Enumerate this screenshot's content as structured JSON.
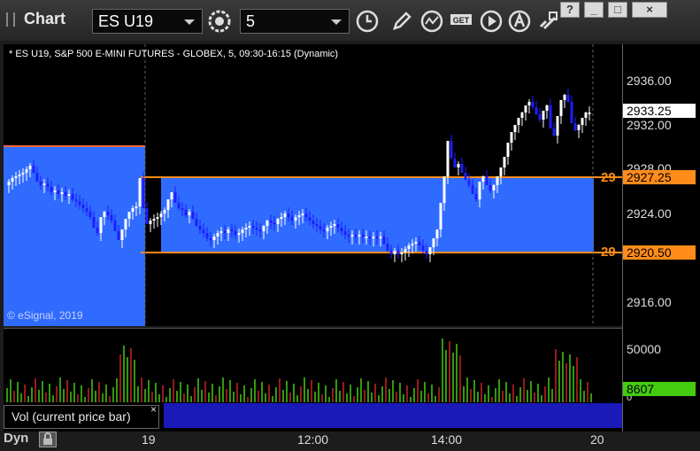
{
  "window": {
    "title": "Chart"
  },
  "toolbar": {
    "symbol": "ES U19",
    "interval": "5",
    "icons": [
      "settings-gear-icon",
      "clock-icon",
      "pencil-draw-icon",
      "study-icon",
      "get-data-icon",
      "play-replay-icon",
      "alert-icon",
      "link-icon"
    ],
    "window_buttons": [
      "?",
      "_",
      "□",
      "×"
    ]
  },
  "chart": {
    "description": "* ES U19, S&P 500 E-MINI FUTURES - GLOBEX, 5, 09:30-16:15 (Dynamic)",
    "copyright": "© eSignal, 2019",
    "price_ticks": [
      "2936.00",
      "2932.00",
      "2928.00",
      "2924.00",
      "2916.00"
    ],
    "last_price": "2933.25",
    "zone_top_label": "2927.25",
    "zone_bottom_label": "2920.50",
    "zone_side_top": "29",
    "zone_side_bottom": "29",
    "x_ticks": [
      "19",
      "12:00",
      "14:00",
      "20"
    ],
    "colors": {
      "zone": "#2f6bff",
      "zone_line": "#ff8c1a",
      "up": "#ffffff",
      "down": "#1e1eff"
    }
  },
  "volume": {
    "label": "Vol (current price bar)",
    "close": "×",
    "ticks": [
      "50000",
      "0"
    ],
    "current": "8607",
    "current_color": "#44cc11"
  },
  "status": {
    "mode": "Dyn"
  }
}
